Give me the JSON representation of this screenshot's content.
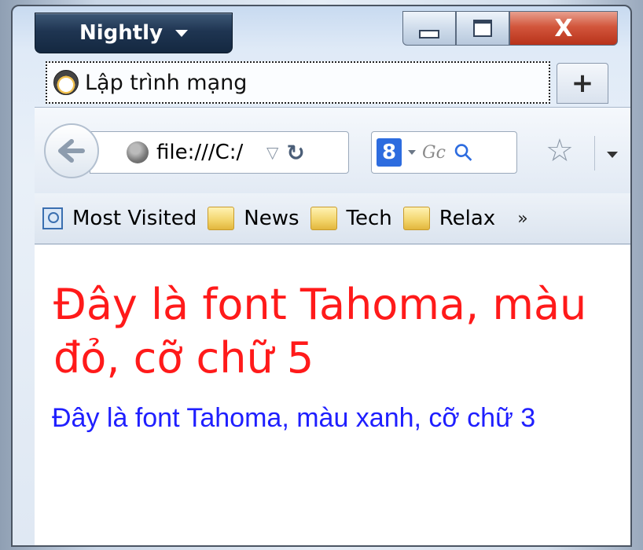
{
  "app_menu": {
    "label": "Nightly"
  },
  "window_controls": {
    "close_label": "X"
  },
  "tab": {
    "title": "Lập trình mạng"
  },
  "new_tab": {
    "label": "+"
  },
  "nav": {
    "url": "file:///C:/",
    "search_placeholder": "Gc"
  },
  "bookmarks": {
    "items": [
      {
        "label": "Most Visited",
        "icon": "search-icon"
      },
      {
        "label": "News",
        "icon": "folder-icon"
      },
      {
        "label": "Tech",
        "icon": "folder-icon"
      },
      {
        "label": "Relax",
        "icon": "folder-icon"
      }
    ],
    "overflow": "»"
  },
  "content": {
    "red_text": "Đây là font Tahoma, màu đỏ, cỡ chữ 5",
    "blue_text": "Đây là font Tahoma, màu xanh, cỡ chữ 3"
  },
  "colors": {
    "red_text": "#ff1a1a",
    "blue_text": "#1f1fff"
  }
}
